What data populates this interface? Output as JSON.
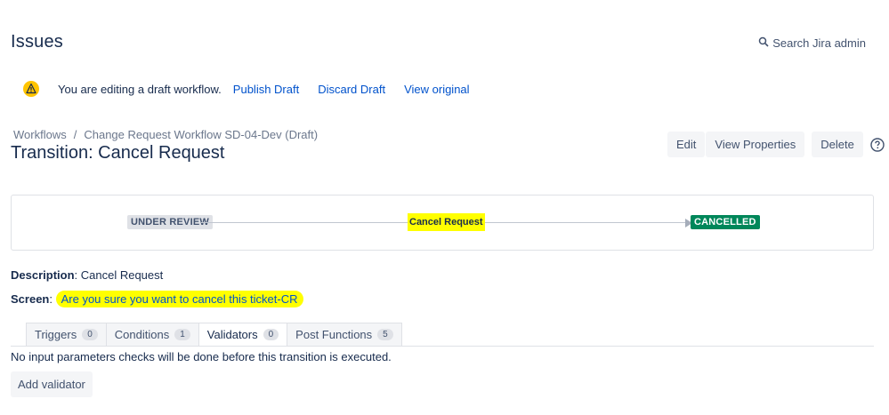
{
  "header": {
    "title": "Issues",
    "search_label": "Search Jira admin"
  },
  "draft_bar": {
    "message": "You are editing a draft workflow.",
    "publish_label": "Publish Draft",
    "discard_label": "Discard Draft",
    "view_original_label": "View original"
  },
  "breadcrumb": {
    "items": [
      "Workflows",
      "Change Request Workflow SD-04-Dev (Draft)"
    ],
    "separator": "/"
  },
  "title": "Transition: Cancel Request",
  "actions": {
    "edit_label": "Edit",
    "view_properties_label": "View Properties",
    "delete_label": "Delete"
  },
  "diagram": {
    "from_status": "UNDER REVIEW",
    "transition_name": "Cancel Request",
    "to_status": "CANCELLED",
    "to_status_color": "#00875a",
    "highlight_color": "#ffff00"
  },
  "details": {
    "description_label": "Description",
    "description_value": "Cancel Request",
    "screen_label": "Screen",
    "screen_value": "Are you sure you want to cancel this ticket-CR"
  },
  "tabs": [
    {
      "label": "Triggers",
      "count": "0"
    },
    {
      "label": "Conditions",
      "count": "1"
    },
    {
      "label": "Validators",
      "count": "0"
    },
    {
      "label": "Post Functions",
      "count": "5"
    }
  ],
  "active_tab": "Validators",
  "validators": {
    "empty_message": "No input parameters checks will be done before this transition is executed.",
    "add_label": "Add validator"
  }
}
